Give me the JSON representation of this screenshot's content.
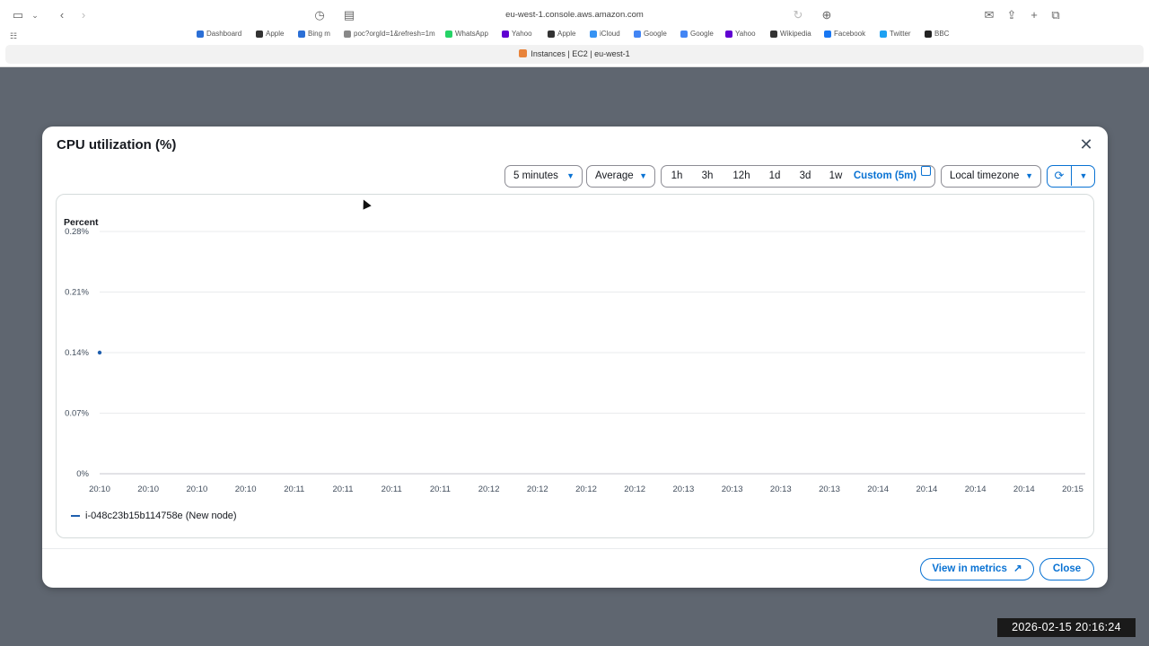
{
  "browser": {
    "url": "eu-west-1.console.aws.amazon.com",
    "tab_title": "Instances | EC2 | eu-west-1",
    "bookmarks": [
      {
        "label": "Dashboard",
        "color": "#2b6fd6"
      },
      {
        "label": "Apple",
        "color": "#333333"
      },
      {
        "label": "Bing m",
        "color": "#2b6fd6"
      },
      {
        "label": "poc?orgId=1&refresh=1m",
        "color": "#888888"
      },
      {
        "label": "WhatsApp",
        "color": "#25d366"
      },
      {
        "label": "Yahoo",
        "color": "#6001d2"
      },
      {
        "label": "Apple",
        "color": "#333333"
      },
      {
        "label": "iCloud",
        "color": "#3693f3"
      },
      {
        "label": "Google",
        "color": "#4285f4"
      },
      {
        "label": "Google",
        "color": "#4285f4"
      },
      {
        "label": "Yahoo",
        "color": "#6001d2"
      },
      {
        "label": "Wikipedia",
        "color": "#333333"
      },
      {
        "label": "Facebook",
        "color": "#1877f2"
      },
      {
        "label": "Twitter",
        "color": "#1da1f2"
      },
      {
        "label": "BBC",
        "color": "#222222"
      }
    ]
  },
  "modal": {
    "title": "CPU utilization (%)",
    "period": "5 minutes",
    "statistic": "Average",
    "ranges": [
      "1h",
      "3h",
      "12h",
      "1d",
      "3d",
      "1w"
    ],
    "custom_range": "Custom (5m)",
    "timezone": "Local timezone",
    "view_in_metrics": "View in metrics",
    "close": "Close"
  },
  "chart_data": {
    "type": "line",
    "ylabel": "Percent",
    "y_ticks": [
      "0.28%",
      "0.21%",
      "0.14%",
      "0.07%",
      "0%"
    ],
    "ylim": [
      0,
      0.28
    ],
    "x_ticks": [
      "20:10",
      "20:10",
      "20:10",
      "20:10",
      "20:11",
      "20:11",
      "20:11",
      "20:11",
      "20:12",
      "20:12",
      "20:12",
      "20:12",
      "20:13",
      "20:13",
      "20:13",
      "20:13",
      "20:14",
      "20:14",
      "20:14",
      "20:14",
      "20:15"
    ],
    "grid": true,
    "legend_position": "bottom-left",
    "series": [
      {
        "name": "i-048c23b15b114758e (New node)",
        "color": "#1f5fae",
        "points": [
          {
            "x": "20:10",
            "y": 0.14
          }
        ]
      }
    ]
  },
  "timestamp": "2026-02-15  20:16:24"
}
